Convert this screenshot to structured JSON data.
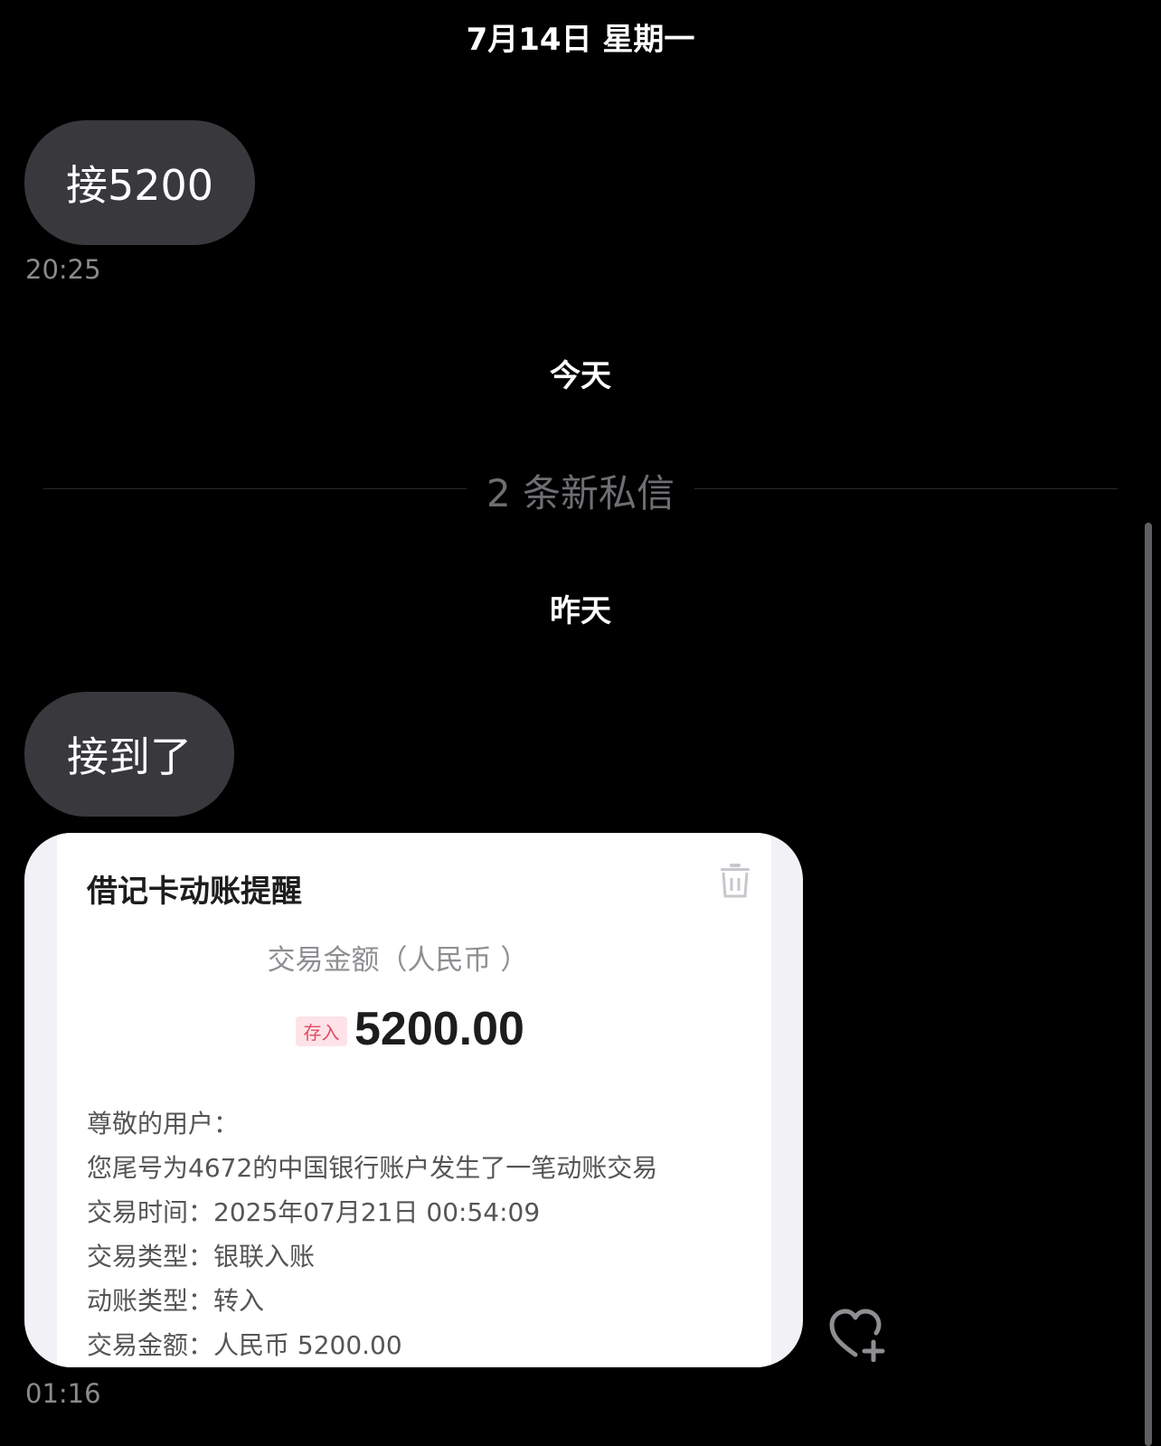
{
  "conversation": {
    "date_header_top": "7月14日 星期一",
    "date_header_today": "今天",
    "date_header_yesterday": "昨天",
    "new_messages_label": "2 条新私信",
    "messages": [
      {
        "text": "接5200",
        "time": "20:25"
      },
      {
        "text": "接到了",
        "time": ""
      }
    ],
    "image_message_time": "01:16"
  },
  "image_card": {
    "title": "借记卡动账提醒",
    "amount_caption": "交易金额（人民币 ）",
    "deposit_tag": "存入",
    "amount": "5200.00",
    "details": [
      "尊敬的用户：",
      "您尾号为4672的中国银行账户发生了一笔动账交易",
      "交易时间：2025年07月21日 00:54:09",
      "交易类型：银联入账",
      "动账类型：转入",
      "交易金额：人民币 5200.00"
    ],
    "icons": [
      "trash-icon"
    ]
  },
  "icons": [
    "heart-add-icon"
  ],
  "colors": {
    "background": "#000000",
    "bubble": "#39393d",
    "timestamp": "#8a8a8e",
    "deposit_tag_bg": "#fde3e8",
    "deposit_tag_text": "#e24a62"
  }
}
